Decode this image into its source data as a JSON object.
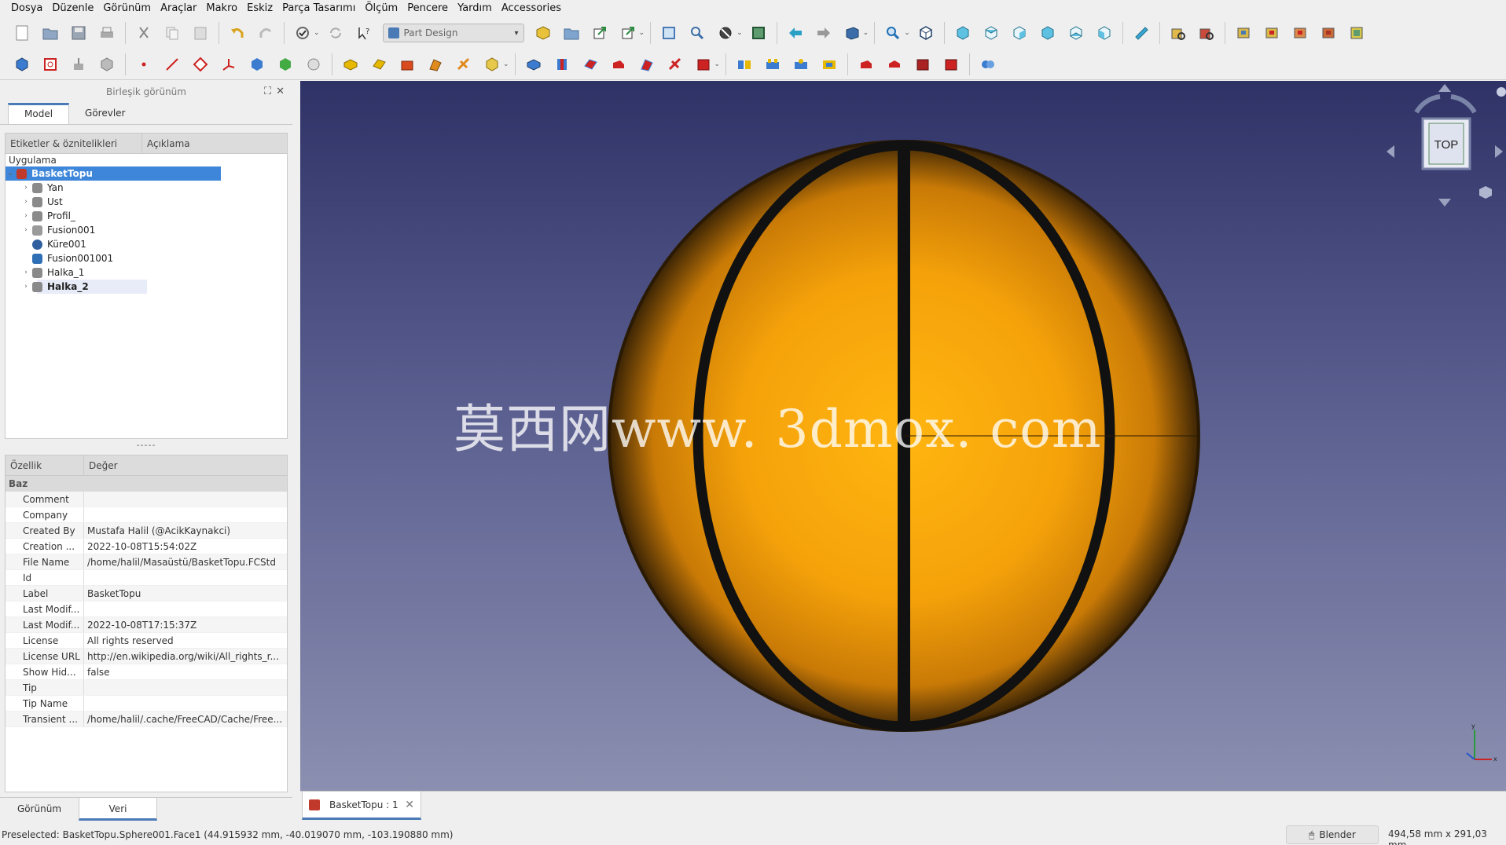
{
  "menubar": [
    "Dosya",
    "Düzenle",
    "Görünüm",
    "Araçlar",
    "Makro",
    "Eskiz",
    "Parça Tasarımı",
    "Ölçüm",
    "Pencere",
    "Yardım",
    "Accessories"
  ],
  "toolbar": {
    "workbench": "Part Design",
    "colors": {
      "accent": "#4a7ab5",
      "part_blue": "#3b7bd0",
      "solid_red": "#cc2222",
      "sketch_yellow": "#e6b800"
    }
  },
  "panel": {
    "title": "Birleşik görünüm",
    "tabs": [
      "Model",
      "Görevler"
    ],
    "tree_headers": [
      "Etiketler & öznitelikleri",
      "Açıklama"
    ],
    "app_label": "Uygulama",
    "root": "BasketTopu",
    "tree_items": [
      {
        "label": "Yan",
        "expand": true,
        "icon": "body"
      },
      {
        "label": "Ust",
        "expand": true,
        "icon": "body"
      },
      {
        "label": "Profil_",
        "expand": true,
        "icon": "body"
      },
      {
        "label": "Fusion001",
        "expand": true,
        "icon": "fusion"
      },
      {
        "label": "Küre001",
        "expand": false,
        "icon": "sphere"
      },
      {
        "label": "Fusion001001",
        "expand": false,
        "icon": "solid"
      },
      {
        "label": "Halka_1",
        "expand": true,
        "icon": "body"
      },
      {
        "label": "Halka_2",
        "expand": true,
        "icon": "body"
      }
    ],
    "prop_headers": [
      "Özellik",
      "Değer"
    ],
    "prop_group": "Baz",
    "props": [
      {
        "name": "Comment",
        "value": ""
      },
      {
        "name": "Company",
        "value": ""
      },
      {
        "name": "Created By",
        "value": "Mustafa Halil (@AcikKaynakci)"
      },
      {
        "name": "Creation ...",
        "value": "2022-10-08T15:54:02Z"
      },
      {
        "name": "File Name",
        "value": "/home/halil/Masaüstü/BasketTopu.FCStd"
      },
      {
        "name": "Id",
        "value": ""
      },
      {
        "name": "Label",
        "value": "BasketTopu"
      },
      {
        "name": "Last Modif...",
        "value": ""
      },
      {
        "name": "Last Modif...",
        "value": "2022-10-08T17:15:37Z"
      },
      {
        "name": "License",
        "value": "All rights reserved"
      },
      {
        "name": "License URL",
        "value": "http://en.wikipedia.org/wiki/All_rights_r..."
      },
      {
        "name": "Show Hid...",
        "value": "false"
      },
      {
        "name": "Tip",
        "value": ""
      },
      {
        "name": "Tip Name",
        "value": ""
      },
      {
        "name": "Transient ...",
        "value": "/home/halil/.cache/FreeCAD/Cache/Free..."
      }
    ],
    "splitter": "-----",
    "bottom_tabs": [
      "Görünüm",
      "Veri"
    ]
  },
  "viewport": {
    "watermark": "莫西网www. 3dmox. com",
    "navcube_face": "TOP",
    "ball_color": "#f5a623"
  },
  "doc_tab": {
    "label": "BasketTopu : 1",
    "close": "✕"
  },
  "status": {
    "text": "Preselected: BasketTopu.Sphere001.Face1 (44.915932 mm, -40.019070 mm, -103.190880 mm)",
    "nav_style": "Blender",
    "dimensions": "494,58 mm x 291,03 mm"
  }
}
